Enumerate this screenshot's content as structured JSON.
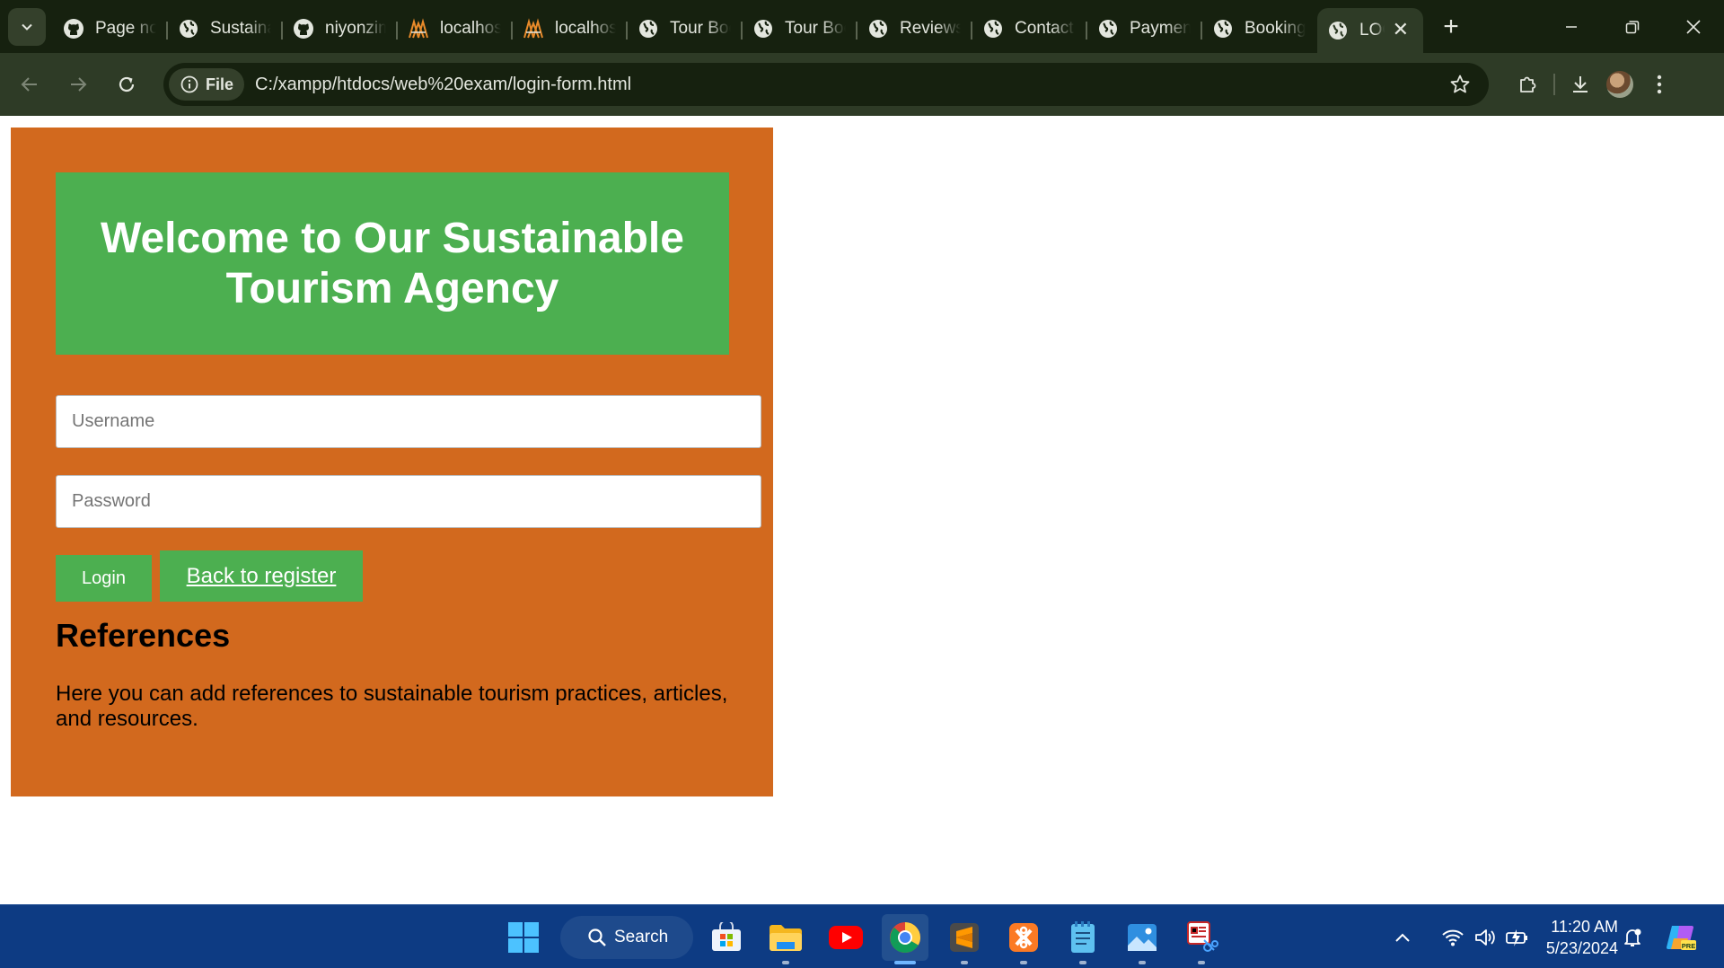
{
  "browser": {
    "tabs": [
      {
        "title": "Page not found",
        "icon": "github-icon"
      },
      {
        "title": "Sustainable",
        "icon": "globe-icon"
      },
      {
        "title": "niyonzima",
        "icon": "github-icon"
      },
      {
        "title": "localhost",
        "icon": "xampp-icon"
      },
      {
        "title": "localhost",
        "icon": "xampp-icon"
      },
      {
        "title": "Tour Booking",
        "icon": "globe-icon"
      },
      {
        "title": "Tour Booking",
        "icon": "globe-icon"
      },
      {
        "title": "Reviews",
        "icon": "globe-icon"
      },
      {
        "title": "Contact",
        "icon": "globe-icon"
      },
      {
        "title": "Payment",
        "icon": "globe-icon"
      },
      {
        "title": "Booking",
        "icon": "globe-icon"
      },
      {
        "title": "LOGIN",
        "icon": "globe-icon",
        "active": true
      }
    ],
    "omnibox": {
      "chip_label": "File",
      "url": "C:/xampp/htdocs/web%20exam/login-form.html"
    }
  },
  "page": {
    "hero_title": "Welcome to Our Sustainable Tourism Agency",
    "username_placeholder": "Username",
    "password_placeholder": "Password",
    "login_label": "Login",
    "back_label": "Back to register",
    "refs_title": "References",
    "refs_text": "Here you can add references to sustainable tourism practices, articles, and resources."
  },
  "taskbar": {
    "search_label": "Search",
    "time": "11:20 AM",
    "date": "5/23/2024"
  },
  "colors": {
    "panel": "#d2691e",
    "accent_green": "#4caf50",
    "chrome_dark": "#16210f",
    "chrome_toolbar": "#2e3b26",
    "taskbar": "#0d3b83"
  }
}
